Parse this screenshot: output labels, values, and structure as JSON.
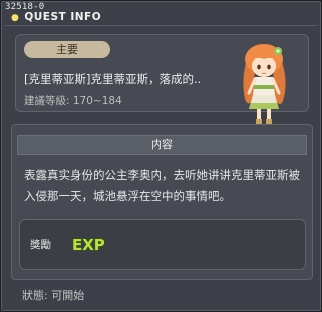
{
  "window": {
    "quest_id": "32518-0",
    "title": "QUEST INFO"
  },
  "quest": {
    "category": "主要",
    "name": "[克里蒂亚斯]克里蒂亚斯，落成的..",
    "level_range": "建議等級: 170~184"
  },
  "content": {
    "header": "内容",
    "description": "表露真实身份的公主李奥内，去听她讲讲克里蒂亚斯被入侵那一天，城池悬浮在空中的事情吧。"
  },
  "reward": {
    "label": "獎勵",
    "icon": "exp-icon"
  },
  "status": {
    "label": "狀態: 可開始"
  },
  "colors": {
    "window_bg": "#3d4048",
    "panel_bg": "#474a52",
    "badge_bg": "#c7b99e",
    "exp_green": "#b7e23a"
  }
}
